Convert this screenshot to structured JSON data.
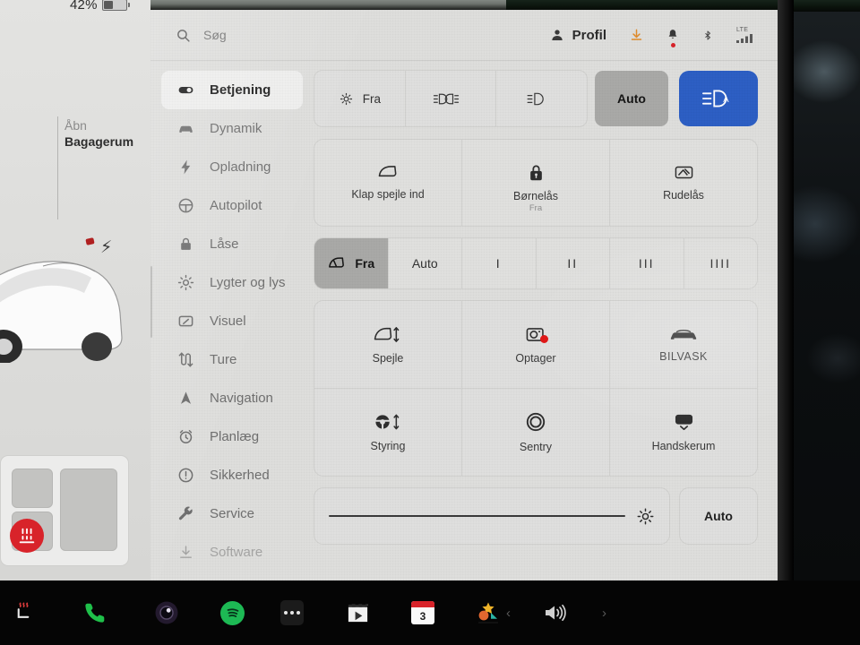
{
  "car_panel": {
    "battery_percent": "42%",
    "trunk_action_line1": "Åbn",
    "trunk_action_line2": "Bagagerum"
  },
  "topbar": {
    "search_placeholder": "Søg",
    "profile_label": "Profil",
    "lte_label": "LTE"
  },
  "sidebar": {
    "items": [
      {
        "label": "Betjening",
        "icon": "toggle-icon",
        "active": true
      },
      {
        "label": "Dynamik",
        "icon": "car-icon",
        "active": false
      },
      {
        "label": "Opladning",
        "icon": "bolt-icon",
        "active": false
      },
      {
        "label": "Autopilot",
        "icon": "steering-icon",
        "active": false
      },
      {
        "label": "Låse",
        "icon": "lock-icon",
        "active": false
      },
      {
        "label": "Lygter og lys",
        "icon": "sun-icon",
        "active": false
      },
      {
        "label": "Visuel",
        "icon": "display-icon",
        "active": false
      },
      {
        "label": "Ture",
        "icon": "route-icon",
        "active": false
      },
      {
        "label": "Navigation",
        "icon": "navigation-icon",
        "active": false
      },
      {
        "label": "Planlæg",
        "icon": "clock-icon",
        "active": false
      },
      {
        "label": "Sikkerhed",
        "icon": "alert-icon",
        "active": false
      },
      {
        "label": "Service",
        "icon": "wrench-icon",
        "active": false
      },
      {
        "label": "Software",
        "icon": "download-icon",
        "active": false
      }
    ]
  },
  "main": {
    "exterior_lights": {
      "options": [
        {
          "label": "Fra",
          "icon": "lights-off-icon",
          "selected": false
        },
        {
          "label": "",
          "icon": "parking-light-icon",
          "selected": false
        },
        {
          "label": "",
          "icon": "low-beam-icon",
          "selected": false
        },
        {
          "label": "Auto",
          "icon": "",
          "selected": true
        }
      ],
      "highbeam_button": {
        "icon": "auto-high-beam-icon",
        "active": true,
        "color": "#2d5fc4"
      }
    },
    "quick_tiles_row1": [
      {
        "label": "Klap spejle ind",
        "sublabel": "",
        "icon": "mirror-fold-icon"
      },
      {
        "label": "Børnelås",
        "sublabel": "Fra",
        "icon": "child-lock-icon"
      },
      {
        "label": "Rudelås",
        "sublabel": "",
        "icon": "window-lock-icon"
      }
    ],
    "wipers": {
      "options": [
        {
          "label": "Fra",
          "icon": "wiper-icon",
          "selected": true
        },
        {
          "label": "Auto",
          "icon": "",
          "selected": false
        },
        {
          "label": "I",
          "icon": "",
          "selected": false
        },
        {
          "label": "II",
          "icon": "",
          "selected": false
        },
        {
          "label": "III",
          "icon": "",
          "selected": false
        },
        {
          "label": "IIII",
          "icon": "",
          "selected": false
        }
      ]
    },
    "feature_grid": [
      {
        "label": "Spejle",
        "icon": "mirror-adjust-icon"
      },
      {
        "label": "Optager",
        "icon": "dashcam-record-icon"
      },
      {
        "label": "BILVASK",
        "icon": "car-wash-icon"
      },
      {
        "label": "Styring",
        "icon": "steering-adjust-icon"
      },
      {
        "label": "Sentry",
        "icon": "sentry-mode-icon"
      },
      {
        "label": "Handskerum",
        "icon": "glovebox-icon"
      }
    ],
    "brightness": {
      "value_percent": 92,
      "icon": "brightness-icon",
      "auto_label": "Auto"
    }
  },
  "taskbar": {
    "items": [
      {
        "name": "seat-heater",
        "icon": "seat-heater-icon",
        "label": ""
      },
      {
        "name": "phone",
        "icon": "phone-icon",
        "label": ""
      },
      {
        "name": "dashcam",
        "icon": "camera-icon",
        "label": ""
      },
      {
        "name": "spotify",
        "icon": "spotify-icon",
        "label": ""
      },
      {
        "name": "apps",
        "icon": "more-dots-icon",
        "label": ""
      },
      {
        "name": "media",
        "icon": "media-player-icon",
        "label": ""
      },
      {
        "name": "calendar",
        "icon": "calendar-icon",
        "label": "3"
      },
      {
        "name": "photos",
        "icon": "photos-icon",
        "label": ""
      }
    ],
    "volume": {
      "prev_icon": "chevron-left-icon",
      "volume_icon": "speaker-icon",
      "next_icon": "chevron-right-icon"
    }
  },
  "colors": {
    "accent_blue": "#2d5fc4",
    "selected_gray": "#a9a9a7",
    "screen_bg": "#dededc",
    "record_red": "#d8232a",
    "spotify_green": "#1db954"
  }
}
